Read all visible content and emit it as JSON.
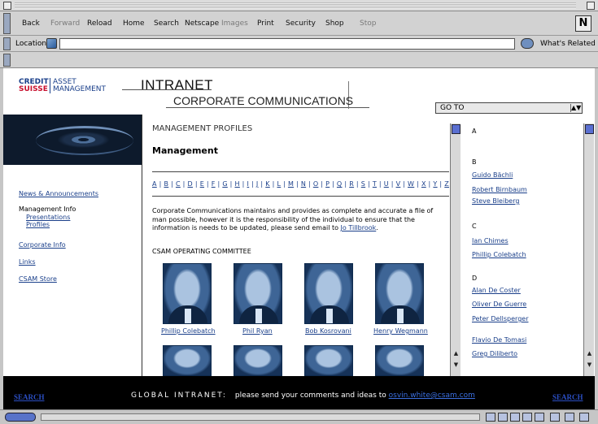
{
  "toolbar": {
    "buttons": [
      {
        "label": "Back",
        "enabled": true
      },
      {
        "label": "Forward",
        "enabled": false
      },
      {
        "label": "Reload",
        "enabled": true
      },
      {
        "label": "Home",
        "enabled": true
      },
      {
        "label": "Search",
        "enabled": true
      },
      {
        "label": "Netscape",
        "enabled": true
      },
      {
        "label": "Images",
        "enabled": false
      },
      {
        "label": "Print",
        "enabled": true
      },
      {
        "label": "Security",
        "enabled": true
      },
      {
        "label": "Shop",
        "enabled": true
      },
      {
        "label": "Stop",
        "enabled": false
      }
    ],
    "logo_letter": "N"
  },
  "location": {
    "label": "Location:",
    "value": "",
    "related_label": "What's Related"
  },
  "header": {
    "logo_credit": "CREDIT",
    "logo_suisse": "SUISSE",
    "logo_asset": "ASSET",
    "logo_management": "MANAGEMENT",
    "intranet": "INTRANET",
    "corp_comm": "CORPORATE COMMUNICATIONS",
    "goto_label": "GO TO"
  },
  "nav": {
    "news": "News & Announcements",
    "mgmt_info": "Management Info",
    "presentations": "Presentations",
    "profiles": "Profiles",
    "corporate_info": "Corporate Info",
    "links": "Links",
    "store": "CSAM Store"
  },
  "main": {
    "section_title": "MANAGEMENT PROFILES",
    "heading": "Management",
    "alphabet": [
      "A",
      "B",
      "C",
      "D",
      "E",
      "F",
      "G",
      "H",
      "I",
      "J",
      "K",
      "L",
      "M",
      "N",
      "O",
      "P",
      "Q",
      "R",
      "S",
      "T",
      "U",
      "V",
      "W",
      "X",
      "Y",
      "Z"
    ],
    "paragraph": "Corporate Communications maintains and provides as complete and accurate a file of man possible, however it is the responsibility of the individual to ensure that the information is needs to be updated, please send email to ",
    "paragraph_link": "Jo Tillbrook",
    "paragraph_end": ".",
    "committee_title": "CSAM OPERATING COMMITTEE",
    "people": [
      "Phillip Colebatch",
      "Phil Ryan",
      "Bob Kosrovani",
      "Henry Wegmann"
    ]
  },
  "directory": {
    "groups": [
      {
        "letter": "A",
        "names": []
      },
      {
        "letter": "B",
        "names": [
          "Guido Bächli",
          "Robert Birnbaum",
          "Steve Bleiberg"
        ]
      },
      {
        "letter": "C",
        "names": [
          "Ian Chimes",
          "Phillip Colebatch"
        ]
      },
      {
        "letter": "D",
        "names": [
          "Alan De Coster",
          "Oliver De Guerre",
          "Peter Dellsperger",
          "Flavio De Tomasi",
          "Greg Diliberto"
        ]
      }
    ]
  },
  "footer": {
    "search_label": "SEARCH",
    "global_label": "GLOBAL INTRANET:",
    "message": "please send your comments and ideas to",
    "email": "osvin.white@csam.com"
  },
  "colors": {
    "link": "#1a3f8a",
    "brand_red": "#c8102e",
    "footer_bg": "#000000",
    "scroll_thumb": "#5a6fd1"
  }
}
